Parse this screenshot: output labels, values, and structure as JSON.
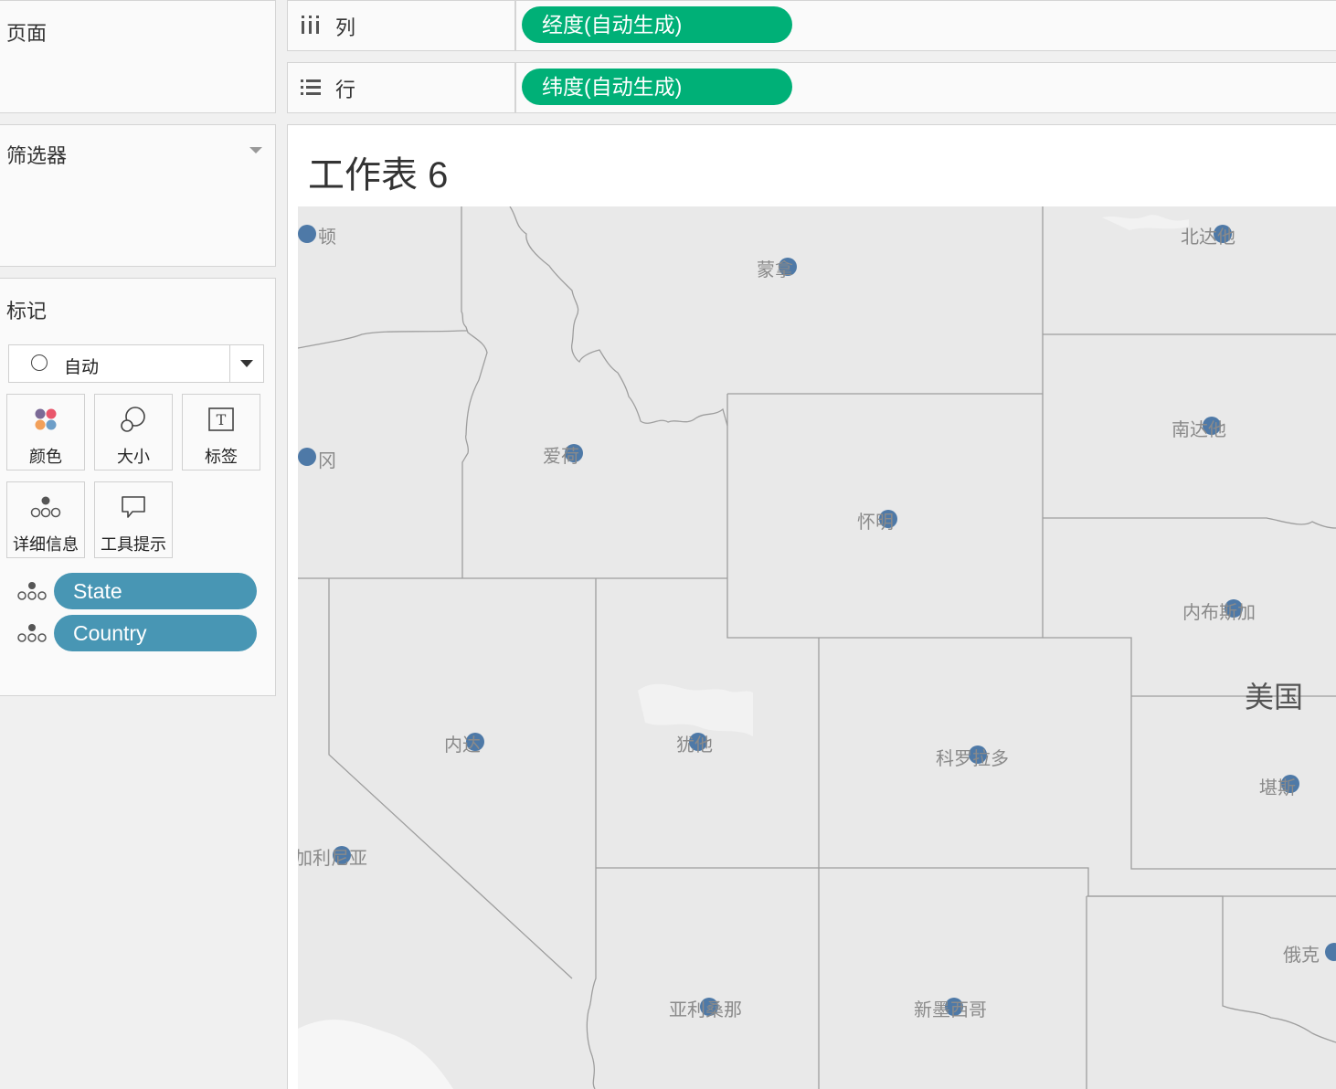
{
  "pages_panel": {
    "title": "页面"
  },
  "filters_panel": {
    "title": "筛选器"
  },
  "marks_panel": {
    "title": "标记",
    "mark_type": "自动",
    "buttons": {
      "color": "颜色",
      "size": "大小",
      "label": "标签",
      "detail": "详细信息",
      "tooltip": "工具提示"
    },
    "detail_pills": [
      "State",
      "Country"
    ]
  },
  "shelves": {
    "columns": {
      "label": "列",
      "pill": "经度(自动生成)"
    },
    "rows": {
      "label": "行",
      "pill": "纬度(自动生成)"
    }
  },
  "worksheet": {
    "title": "工作表 6"
  },
  "map": {
    "country_label": "美国",
    "mark_color": "#4e79a7",
    "states": [
      {
        "name": "华盛顿",
        "shown": "顿"
      },
      {
        "name": "蒙大拿",
        "shown": "蒙拿"
      },
      {
        "name": "北达科他",
        "shown": "北达他"
      },
      {
        "name": "俄勒冈",
        "shown": "冈"
      },
      {
        "name": "爱达荷",
        "shown": "爱荷"
      },
      {
        "name": "南达科他",
        "shown": "南达他"
      },
      {
        "name": "怀俄明",
        "shown": "怀明"
      },
      {
        "name": "内布拉斯加",
        "shown": "内布斯加"
      },
      {
        "name": "内华达",
        "shown": "内达"
      },
      {
        "name": "犹他",
        "shown": "犹他"
      },
      {
        "name": "科罗拉多",
        "shown": "科罗拉多"
      },
      {
        "name": "堪萨斯",
        "shown": "堪斯"
      },
      {
        "name": "加利福尼亚",
        "shown": "加利尼亚"
      },
      {
        "name": "亚利桑那",
        "shown": "亚利桑那"
      },
      {
        "name": "新墨西哥",
        "shown": "新墨西哥"
      },
      {
        "name": "俄克拉何马",
        "shown": "俄克"
      }
    ]
  }
}
